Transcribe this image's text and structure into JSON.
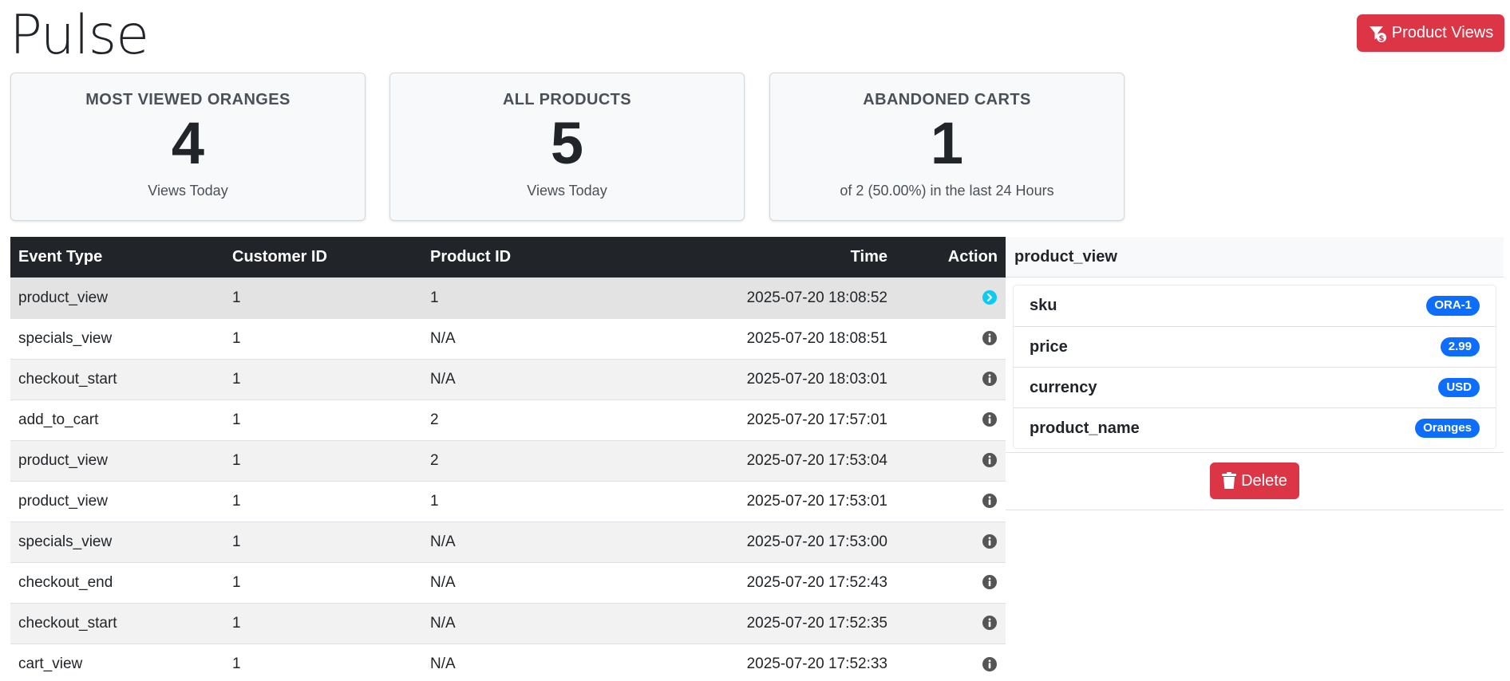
{
  "app": {
    "title": "Pulse"
  },
  "header": {
    "product_views_label": "Product Views"
  },
  "stats": [
    {
      "title": "MOST VIEWED ORANGES",
      "value": "4",
      "sub": "Views Today"
    },
    {
      "title": "ALL PRODUCTS",
      "value": "5",
      "sub": "Views Today"
    },
    {
      "title": "ABANDONED CARTS",
      "value": "1",
      "sub": "of 2 (50.00%) in the last 24 Hours"
    }
  ],
  "table": {
    "headers": {
      "event_type": "Event Type",
      "customer_id": "Customer ID",
      "product_id": "Product ID",
      "time": "Time",
      "action": "Action"
    },
    "rows": [
      {
        "event_type": "product_view",
        "customer_id": "1",
        "product_id": "1",
        "time": "2025-07-20 18:08:52"
      },
      {
        "event_type": "specials_view",
        "customer_id": "1",
        "product_id": "N/A",
        "time": "2025-07-20 18:08:51"
      },
      {
        "event_type": "checkout_start",
        "customer_id": "1",
        "product_id": "N/A",
        "time": "2025-07-20 18:03:01"
      },
      {
        "event_type": "add_to_cart",
        "customer_id": "1",
        "product_id": "2",
        "time": "2025-07-20 17:57:01"
      },
      {
        "event_type": "product_view",
        "customer_id": "1",
        "product_id": "2",
        "time": "2025-07-20 17:53:04"
      },
      {
        "event_type": "product_view",
        "customer_id": "1",
        "product_id": "1",
        "time": "2025-07-20 17:53:01"
      },
      {
        "event_type": "specials_view",
        "customer_id": "1",
        "product_id": "N/A",
        "time": "2025-07-20 17:53:00"
      },
      {
        "event_type": "checkout_end",
        "customer_id": "1",
        "product_id": "N/A",
        "time": "2025-07-20 17:52:43"
      },
      {
        "event_type": "checkout_start",
        "customer_id": "1",
        "product_id": "N/A",
        "time": "2025-07-20 17:52:35"
      },
      {
        "event_type": "cart_view",
        "customer_id": "1",
        "product_id": "N/A",
        "time": "2025-07-20 17:52:33"
      }
    ]
  },
  "detail": {
    "title": "product_view",
    "items": [
      {
        "key": "sku",
        "value": "ORA-1"
      },
      {
        "key": "price",
        "value": "2.99"
      },
      {
        "key": "currency",
        "value": "USD"
      },
      {
        "key": "product_name",
        "value": "Oranges"
      }
    ],
    "delete_label": "Delete"
  },
  "colors": {
    "danger": "#dc3545",
    "primary": "#0d6efd",
    "info": "#0dcaf0",
    "dark": "#212529",
    "icon_gray": "#555555"
  },
  "icons": {
    "product_views": "filter-dollar-icon",
    "row_action": "info-circle-icon",
    "selected_action": "chevron-right-circle-icon",
    "delete": "trash-icon"
  }
}
